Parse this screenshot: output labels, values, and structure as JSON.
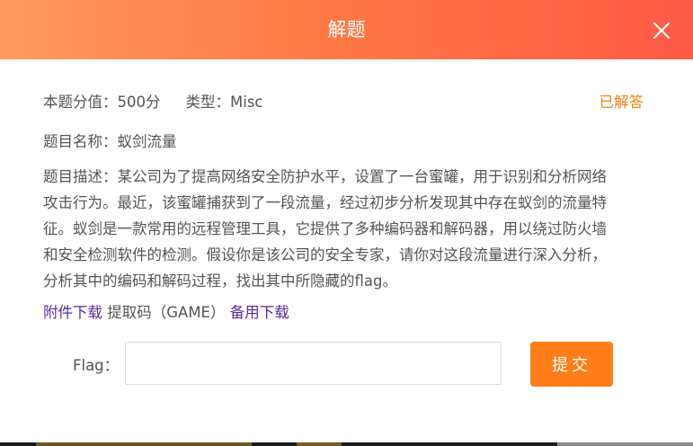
{
  "header": {
    "title": "解题"
  },
  "meta": {
    "score": "本题分值：500分",
    "type": "类型：Misc",
    "status": "已解答"
  },
  "challenge": {
    "name": "题目名称：蚁剑流量",
    "description_lines": [
      "题目描述：某公司为了提高网络安全防护水平，设置了一台蜜罐，用于识别和分析网络",
      "攻击行为。最近，该蜜罐捕获到了一段流量，经过初步分析发现其中存在蚁剑的流量特",
      "征。蚁剑是一款常用的远程管理工具，它提供了多种编码器和解码器，用以绕过防火墙",
      "和安全检测软件的检测。假设你是该公司的安全专家，请你对这段流量进行深入分析，",
      "分析其中的编码和解码过程，找出其中所隐藏的flag。"
    ]
  },
  "attachment": {
    "download_label": "附件下载",
    "code_text": " 提取码（GAME）",
    "backup_label": "备用下载"
  },
  "form": {
    "flag_label": "Flag：",
    "flag_value": "",
    "flag_placeholder": "",
    "submit_label": "提交"
  },
  "colors": {
    "header_gradient_start": "#ff9a5c",
    "header_gradient_end": "#ff5a45",
    "accent_orange": "#ff7e1a",
    "solved_text": "#f08519",
    "link_purple": "#5b2b9a",
    "body_text": "#555555"
  },
  "icons": {
    "close": "close-icon"
  }
}
